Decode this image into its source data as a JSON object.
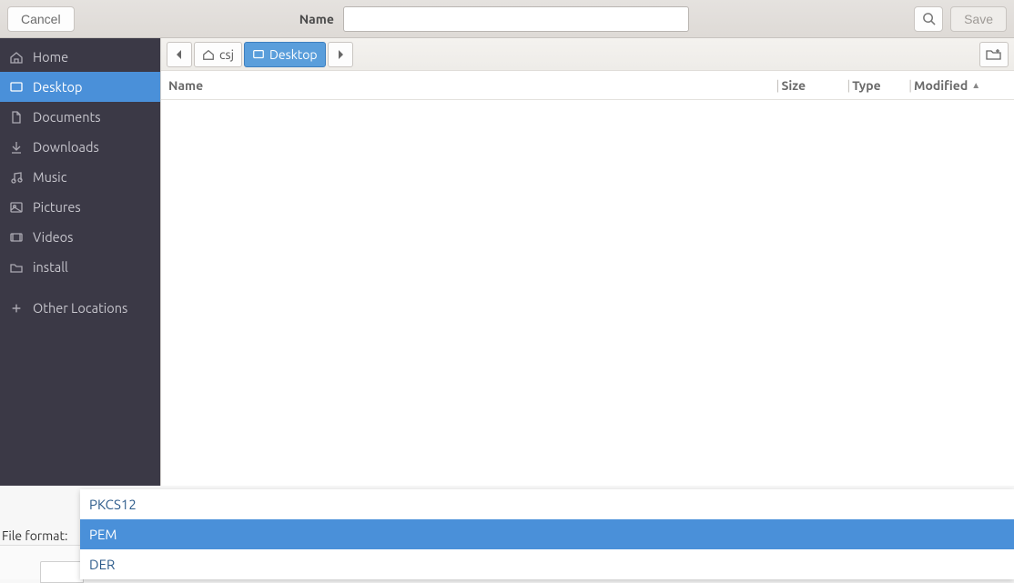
{
  "header": {
    "cancel_label": "Cancel",
    "name_label": "Name",
    "name_value": "",
    "save_label": "Save"
  },
  "sidebar": {
    "items": [
      {
        "label": "Home",
        "icon": "home"
      },
      {
        "label": "Desktop",
        "icon": "desktop",
        "selected": true
      },
      {
        "label": "Documents",
        "icon": "documents"
      },
      {
        "label": "Downloads",
        "icon": "downloads"
      },
      {
        "label": "Music",
        "icon": "music"
      },
      {
        "label": "Pictures",
        "icon": "pictures"
      },
      {
        "label": "Videos",
        "icon": "videos"
      },
      {
        "label": "install",
        "icon": "folder"
      }
    ],
    "other_locations_label": "Other Locations"
  },
  "pathbar": {
    "segments": [
      {
        "label": "csj",
        "icon": "home"
      },
      {
        "label": "Desktop",
        "icon": "desktop",
        "current": true
      }
    ]
  },
  "columns": {
    "name": "Name",
    "size": "Size",
    "type": "Type",
    "modified": "Modified",
    "sort_direction": "asc"
  },
  "file_format": {
    "label": "File format:",
    "options": [
      "PKCS12",
      "PEM",
      "DER"
    ],
    "selected": "PEM"
  }
}
